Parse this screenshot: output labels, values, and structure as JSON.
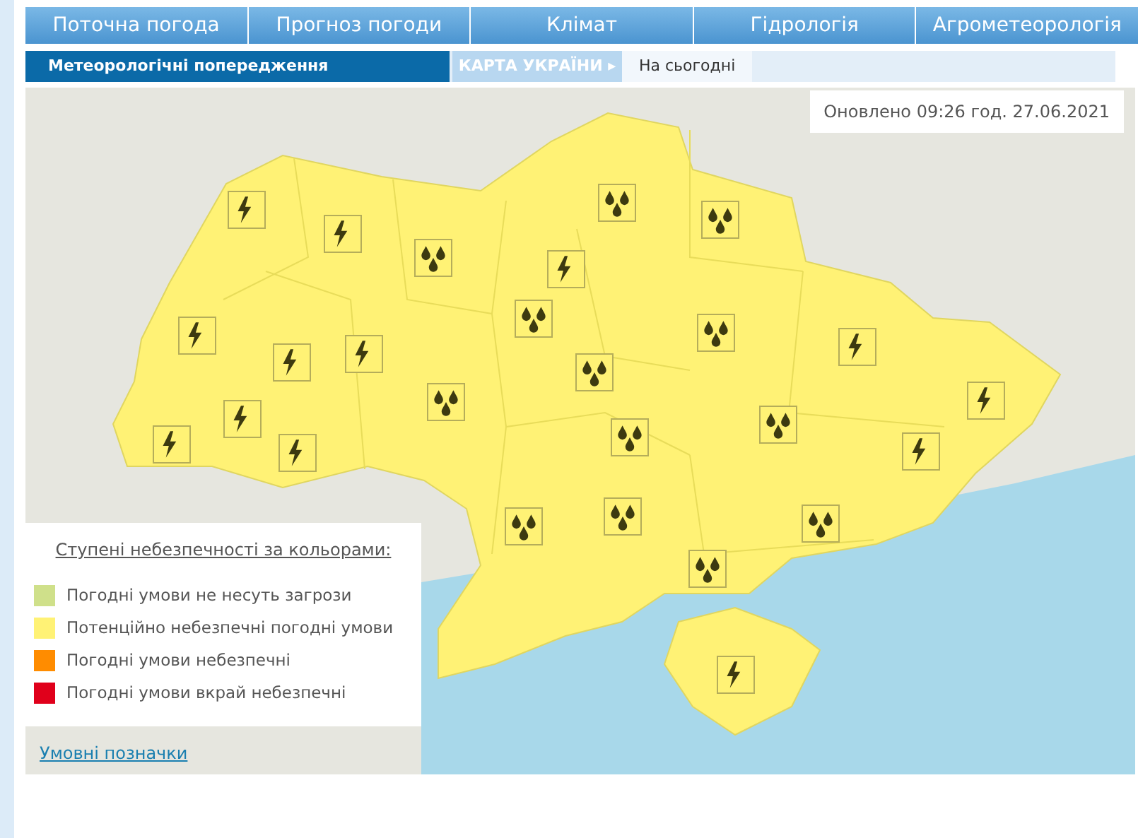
{
  "main_nav": [
    {
      "label": "Поточна погода"
    },
    {
      "label": "Прогноз погоди"
    },
    {
      "label": "Клімат"
    },
    {
      "label": "Гідрологія"
    },
    {
      "label": "Агрометеорологія"
    }
  ],
  "sub_nav": {
    "section": "Метеорологічні попередження",
    "crumb": "КАРТА УКРАЇНИ",
    "crumb_arrow": "▸",
    "tabs": [
      {
        "label": "На сьогодні",
        "selected": true
      }
    ]
  },
  "map": {
    "updated": "Оновлено 09:26 год. 27.06.2021",
    "markers": [
      {
        "kind": "thunderstorm"
      },
      {
        "kind": "thunderstorm"
      },
      {
        "kind": "thunderstorm"
      },
      {
        "kind": "thunderstorm"
      },
      {
        "kind": "thunderstorm"
      },
      {
        "kind": "thunderstorm"
      },
      {
        "kind": "thunderstorm"
      },
      {
        "kind": "thunderstorm"
      },
      {
        "kind": "thunderstorm"
      },
      {
        "kind": "thunderstorm"
      },
      {
        "kind": "thunderstorm"
      },
      {
        "kind": "thunderstorm"
      },
      {
        "kind": "thunderstorm"
      },
      {
        "kind": "rain"
      },
      {
        "kind": "rain"
      },
      {
        "kind": "rain"
      },
      {
        "kind": "rain"
      },
      {
        "kind": "rain"
      },
      {
        "kind": "rain"
      },
      {
        "kind": "rain"
      },
      {
        "kind": "rain"
      },
      {
        "kind": "rain"
      },
      {
        "kind": "rain"
      },
      {
        "kind": "rain"
      },
      {
        "kind": "rain"
      },
      {
        "kind": "rain"
      }
    ],
    "legend": {
      "title": "Ступені небезпечності за кольорами:",
      "items": [
        {
          "label": "Погодні умови не несуть загрози",
          "color": "#cfe08a"
        },
        {
          "label": "Потенційно небезпечні погодні умови",
          "color": "#fff275"
        },
        {
          "label": "Погодні умови небезпечні",
          "color": "#ff8c00"
        },
        {
          "label": "Погодні умови вкрай небезпечні",
          "color": "#e0001b"
        }
      ]
    },
    "link": "Умовні позначки"
  }
}
